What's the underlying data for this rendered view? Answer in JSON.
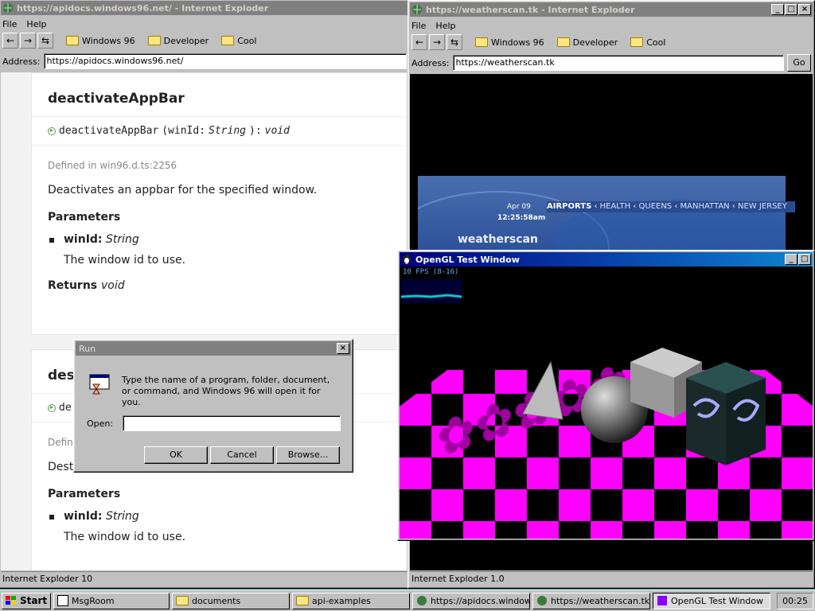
{
  "ie_left": {
    "title": "https://apidocs.windows96.net/ - Internet Exploder",
    "menu": [
      "File",
      "Help"
    ],
    "favorites": [
      "Windows 96",
      "Developer",
      "Cool"
    ],
    "address_label": "Address:",
    "address_value": "https://apidocs.windows96.net/",
    "status": "Internet Exploder 10"
  },
  "doc": {
    "card1": {
      "heading": "deactivateAppBar",
      "signature_name": "deactivateAppBar",
      "signature_args": "(winId: ",
      "signature_type": "String",
      "signature_ret_sep": "): ",
      "signature_ret": "void",
      "defined": "Defined in win96.d.ts:2256",
      "description": "Deactivates an appbar for the specified window.",
      "params_heading": "Parameters",
      "param_name": "winId:",
      "param_type": "String",
      "param_desc": "The window id to use.",
      "returns_label": "Returns",
      "returns_type": "void"
    },
    "card2": {
      "heading": "dest",
      "signature_partial": "de",
      "defined_partial": "Defin",
      "description": "Destroys an appbar.",
      "params_heading": "Parameters",
      "param_name": "winId:",
      "param_type": "String",
      "param_desc": "The window id to use."
    }
  },
  "ie_right": {
    "title": "https://weatherscan.tk - Internet Exploder",
    "menu": [
      "File",
      "Help"
    ],
    "favorites": [
      "Windows 96",
      "Developer",
      "Cool"
    ],
    "address_label": "Address:",
    "address_value": "https://weatherscan.tk",
    "go_label": "Go",
    "status": "Internet Exploder 1.0",
    "weatherscan": {
      "date": "Apr 09",
      "time": "12:25:58am",
      "logo": "weatherscan",
      "ticker_active": "AIRPORTS",
      "ticker_items": [
        "HEALTH",
        "QUEENS",
        "MANHATTAN",
        "NEW JERSEY"
      ]
    }
  },
  "opengl": {
    "title": "OpenGL Test Window",
    "fps": "10 FPS (8-16)",
    "colors": {
      "floor_a": "#ff00ff",
      "floor_b": "#000000",
      "text3d": "#b000b0"
    }
  },
  "run_dialog": {
    "title": "Run",
    "message": "Type the name of a program, folder, document, or command, and Windows 96 will open it for you.",
    "open_label": "Open:",
    "open_value": "",
    "ok": "OK",
    "cancel": "Cancel",
    "browse": "Browse..."
  },
  "taskbar": {
    "start": "Start",
    "tasks": [
      "MsgRoom",
      "documents",
      "api-examples",
      "https://apidocs.window...",
      "https://weatherscan.tk...",
      "OpenGL Test Window"
    ],
    "clock": "00:25"
  }
}
